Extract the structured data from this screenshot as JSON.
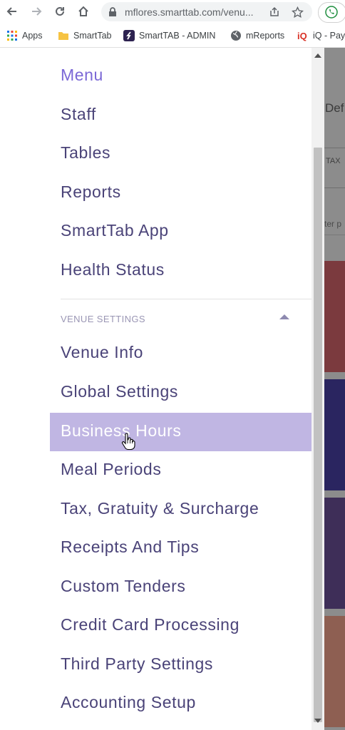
{
  "browser": {
    "url": "mflores.smarttab.com/venu...",
    "bookmarks": [
      {
        "label": "Apps",
        "icon": "apps-grid-icon"
      },
      {
        "label": "SmartTab",
        "icon": "folder-icon"
      },
      {
        "label": "SmartTAB - ADMIN",
        "icon": "smarttab-logo-icon"
      },
      {
        "label": "mReports",
        "icon": "globe-icon"
      },
      {
        "label": "iQ - Pay",
        "icon": "iq-logo-icon"
      }
    ]
  },
  "sidebar": {
    "title": "Menu",
    "items": [
      {
        "label": "Staff"
      },
      {
        "label": "Tables"
      },
      {
        "label": "Reports"
      },
      {
        "label": "SmartTab App"
      },
      {
        "label": "Health Status"
      }
    ],
    "section": {
      "label": "VENUE SETTINGS",
      "expanded": true,
      "items": [
        {
          "label": "Venue Info",
          "active": false
        },
        {
          "label": "Global Settings",
          "active": false
        },
        {
          "label": "Business Hours",
          "active": true
        },
        {
          "label": "Meal Periods",
          "active": false
        },
        {
          "label": "Tax, Gratuity & Surcharge",
          "active": false
        },
        {
          "label": "Receipts And Tips",
          "active": false
        },
        {
          "label": "Custom Tenders",
          "active": false
        },
        {
          "label": "Credit Card Processing",
          "active": false
        },
        {
          "label": "Third Party Settings",
          "active": false
        },
        {
          "label": "Accounting Setup",
          "active": false
        }
      ]
    }
  },
  "background_page": {
    "heading_fragment": "Def",
    "column_fragment": "TAX",
    "input_fragment": "ter p",
    "card_colors": [
      "#7b3a3e",
      "#2a2560",
      "#3e2e58",
      "#8e5f52"
    ]
  },
  "colors": {
    "accent": "#7b68d6",
    "active_bg": "#c0b6e3",
    "menu_text": "#4a4378"
  }
}
